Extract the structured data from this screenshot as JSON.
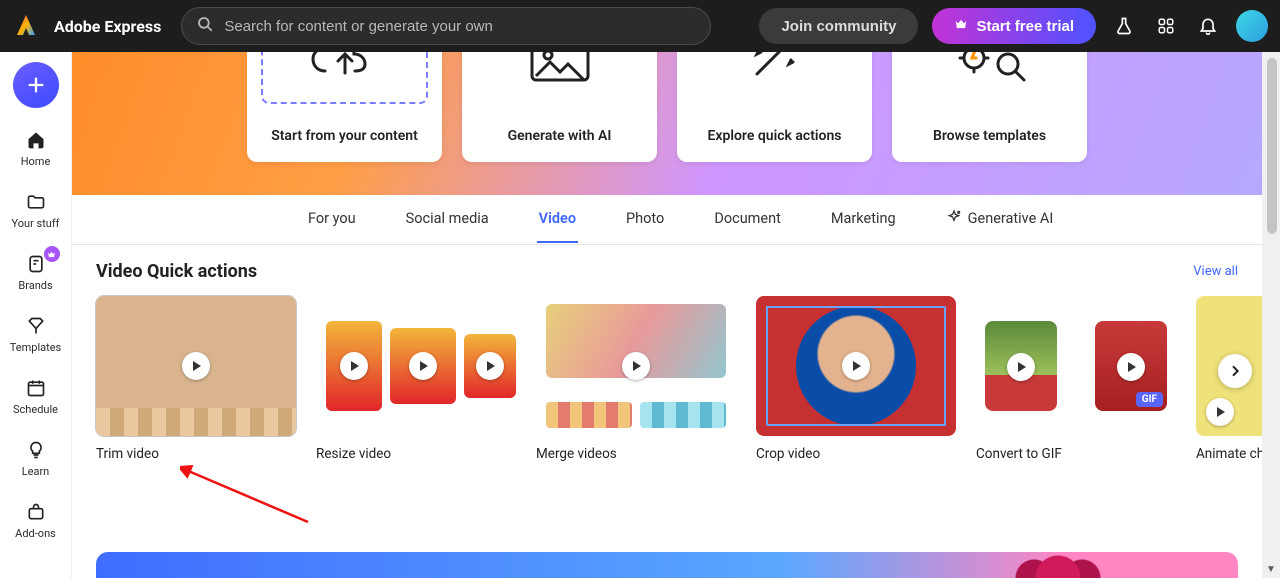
{
  "brand": "Adobe Express",
  "search": {
    "placeholder": "Search for content or generate your own"
  },
  "top": {
    "join": "Join community",
    "trial": "Start free trial"
  },
  "sidebar": {
    "items": [
      {
        "label": "Home"
      },
      {
        "label": "Your stuff"
      },
      {
        "label": "Brands"
      },
      {
        "label": "Templates"
      },
      {
        "label": "Schedule"
      },
      {
        "label": "Learn"
      },
      {
        "label": "Add-ons"
      }
    ]
  },
  "hero": {
    "cards": [
      {
        "label": "Start from your content"
      },
      {
        "label": "Generate with AI"
      },
      {
        "label": "Explore quick actions"
      },
      {
        "label": "Browse templates"
      }
    ]
  },
  "tabs": {
    "items": [
      {
        "label": "For you"
      },
      {
        "label": "Social media"
      },
      {
        "label": "Video"
      },
      {
        "label": "Photo"
      },
      {
        "label": "Document"
      },
      {
        "label": "Marketing"
      },
      {
        "label": "Generative AI"
      }
    ],
    "active_index": 2
  },
  "section": {
    "title": "Video Quick actions",
    "view_all": "View all",
    "cards": [
      {
        "label": "Trim video"
      },
      {
        "label": "Resize video"
      },
      {
        "label": "Merge videos"
      },
      {
        "label": "Crop video"
      },
      {
        "label": "Convert to GIF"
      },
      {
        "label": "Animate characte"
      }
    ]
  },
  "gif_badge": "GIF"
}
